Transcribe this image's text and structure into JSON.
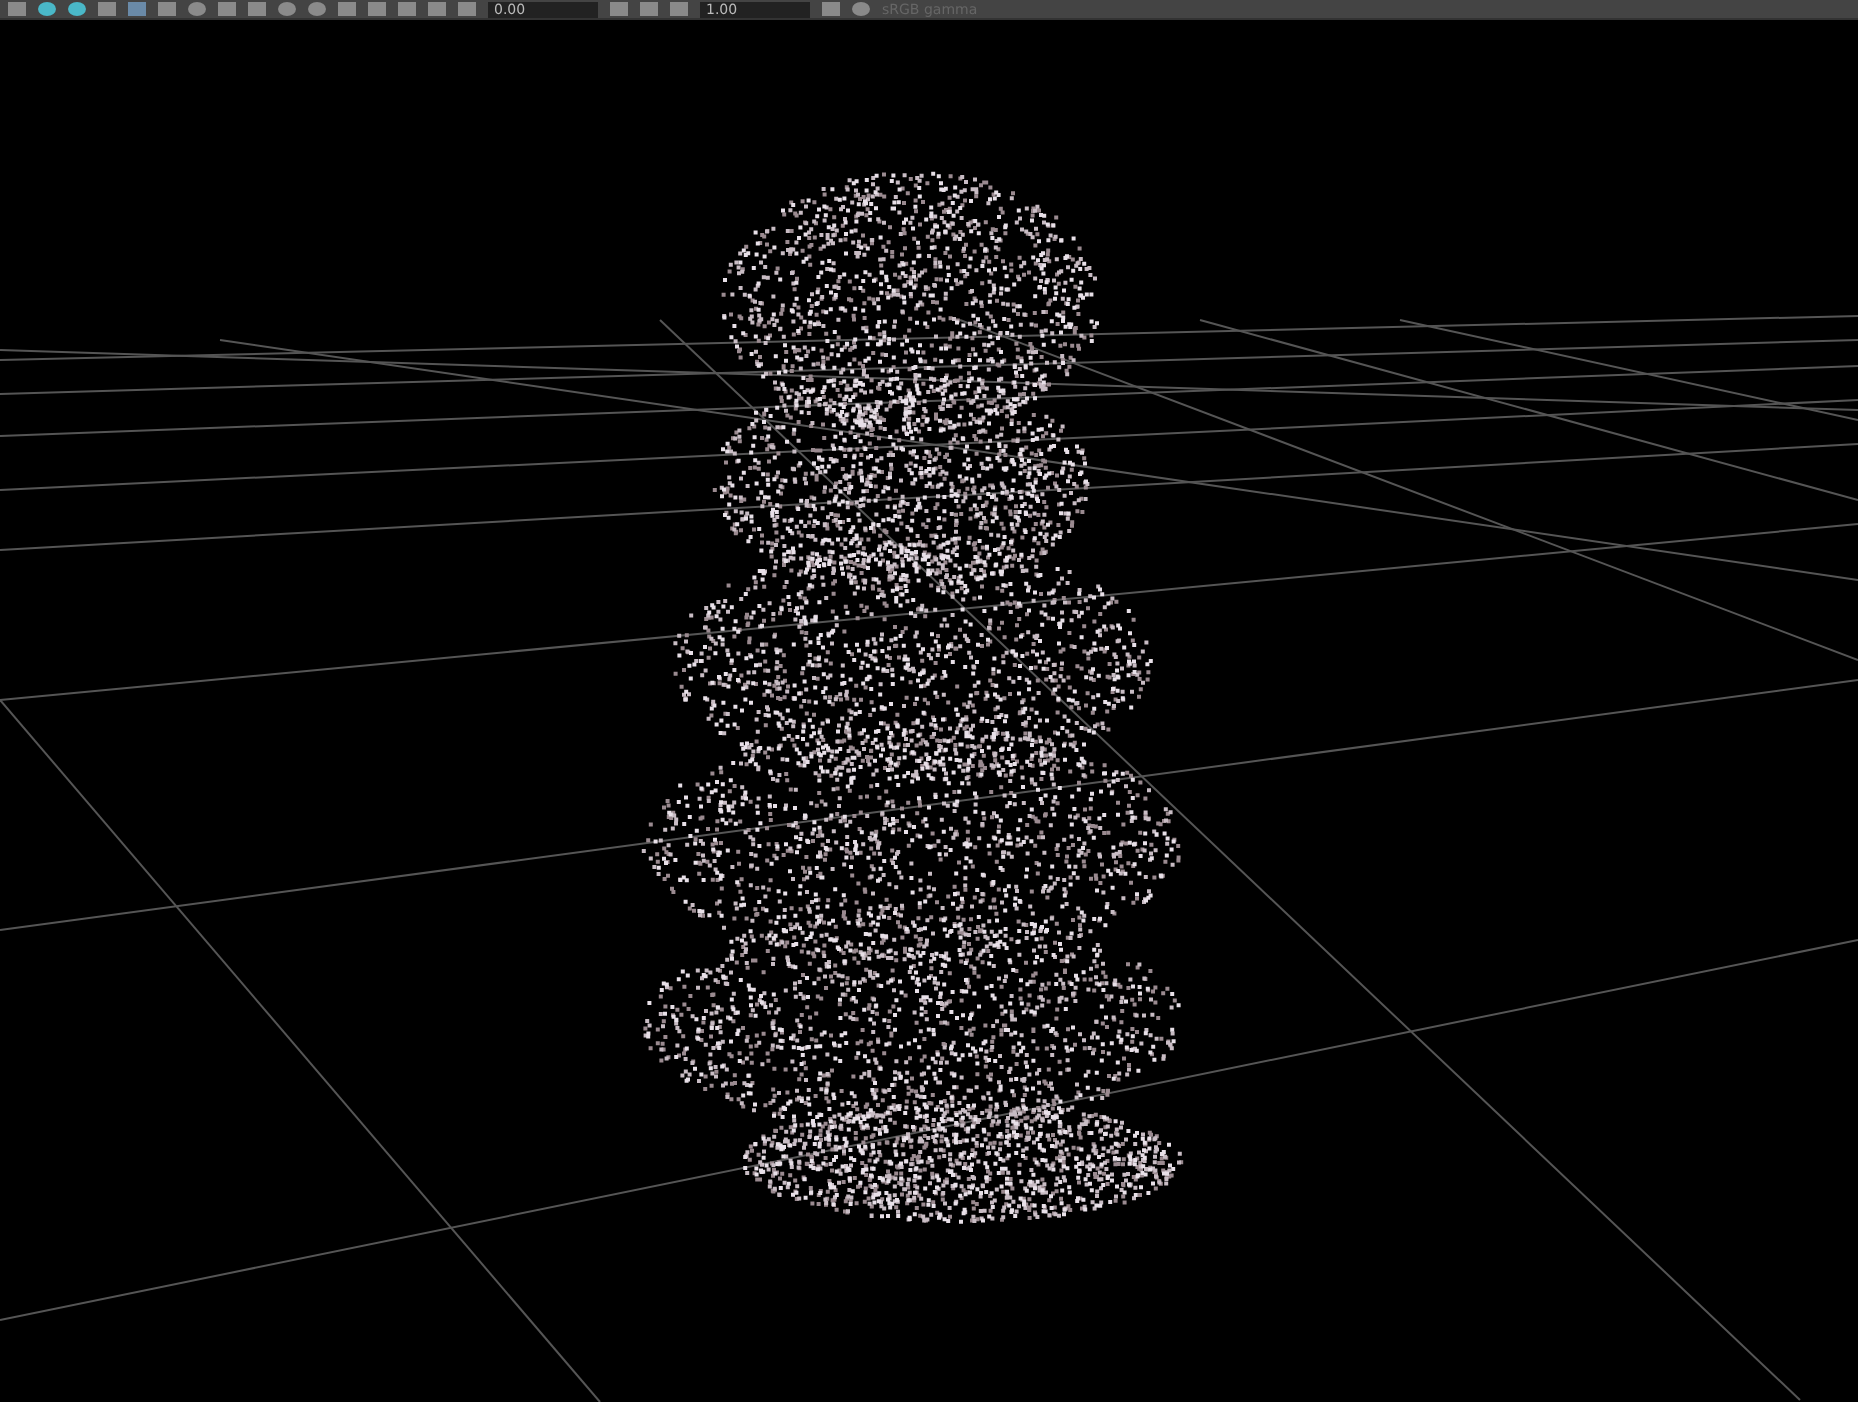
{
  "toolbar": {
    "exposure_field": {
      "value": "0.00"
    },
    "gamma_field": {
      "value": "1.00"
    },
    "color_space_label": "sRGB gamma"
  }
}
